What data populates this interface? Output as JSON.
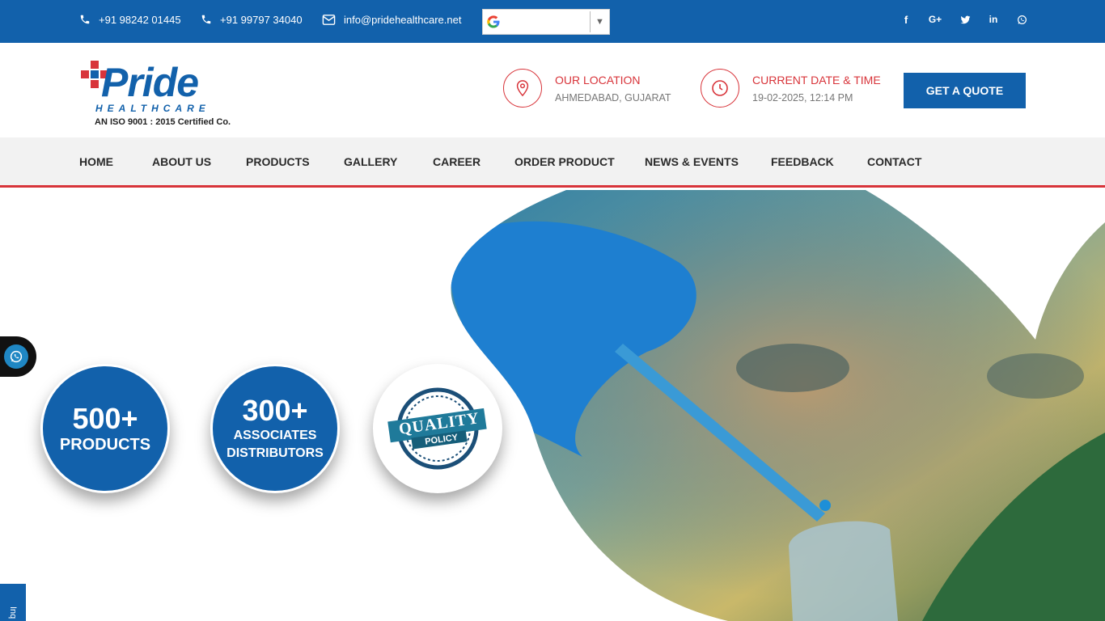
{
  "topbar": {
    "phone1": "+91 98242 01445",
    "phone2": "+91 99797 34040",
    "email": "info@pridehealthcare.net",
    "language_icon": "google-translate-icon",
    "language_value": "",
    "social_icons": [
      "facebook-icon",
      "google-plus-icon",
      "twitter-icon",
      "linkedin-icon",
      "whatsapp-icon"
    ]
  },
  "logo": {
    "brand": "Pride",
    "subtitle": "HEALTHCARE",
    "certification": "AN ISO 9001 : 2015 Certified Co."
  },
  "header": {
    "location_title": "OUR LOCATION",
    "location_value": "AHMEDABAD, GUJARAT",
    "datetime_title": "CURRENT DATE & TIME",
    "datetime_value": "19-02-2025, 12:14 PM",
    "quote_button": "GET A QUOTE"
  },
  "nav": {
    "items": [
      "HOME",
      "ABOUT US",
      "PRODUCTS",
      "GALLERY",
      "CAREER",
      "ORDER PRODUCT",
      "NEWS & EVENTS",
      "FEEDBACK",
      "CONTACT"
    ]
  },
  "hero": {
    "stat1_number": "500+",
    "stat1_label": "PRODUCTS",
    "stat2_number": "300+",
    "stat2_label_line1": "ASSOCIATES",
    "stat2_label_line2": "DISTRIBUTORS",
    "badge_line1": "QUALITY",
    "badge_line2": "POLICY"
  },
  "side": {
    "enquiry_tab": "Inq"
  },
  "colors": {
    "primary": "#1261ab",
    "accent": "#d8343a",
    "nav_bg": "#f2f2f2"
  }
}
